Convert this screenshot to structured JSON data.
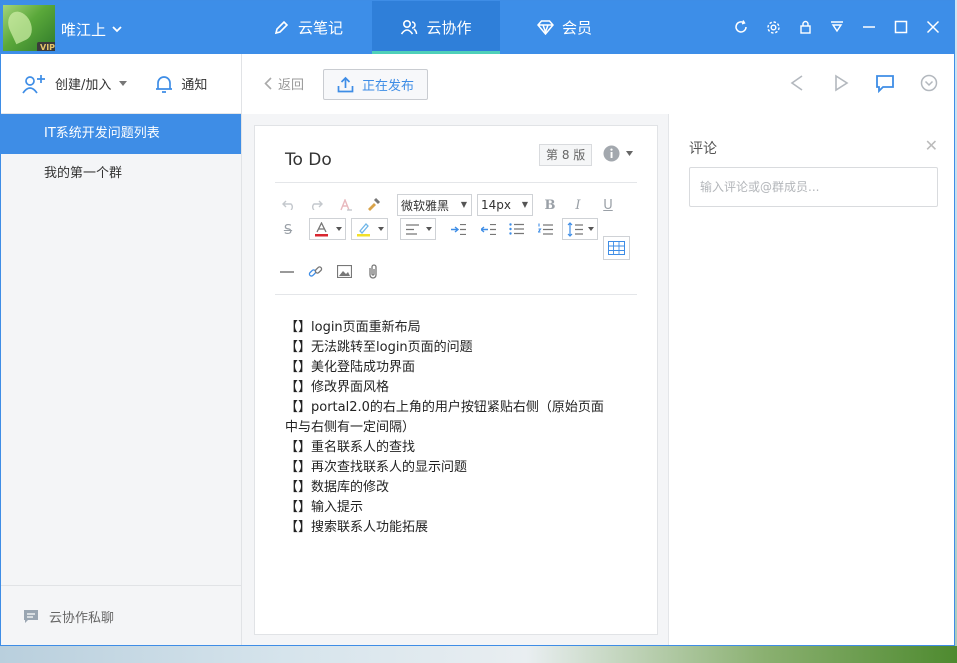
{
  "titlebar": {
    "username": "唯江上",
    "vip_badge": "VIP",
    "tabs": [
      {
        "label": "云笔记",
        "icon": "pencil-icon"
      },
      {
        "label": "云协作",
        "icon": "users-icon"
      },
      {
        "label": "会员",
        "icon": "diamond-icon"
      }
    ],
    "window_icons": [
      "refresh-icon",
      "gear-icon",
      "lock-icon",
      "skin-icon",
      "minimize-icon",
      "maximize-icon",
      "close-icon"
    ]
  },
  "sidebar": {
    "create_join": "创建/加入",
    "notify": "通知",
    "groups": [
      "IT系统开发问题列表",
      "我的第一个群"
    ],
    "footer": "云协作私聊"
  },
  "toolbar": {
    "back": "返回",
    "publish": "正在发布"
  },
  "document": {
    "title": "To Do",
    "version": "第 8 版",
    "font_family": "微软雅黑",
    "font_size": "14px",
    "lines": [
      "【】login页面重新布局",
      "【】无法跳转至login页面的问题",
      "【】美化登陆成功界面",
      "【】修改界面风格",
      "【】portal2.0的右上角的用户按钮紧贴右侧（原始页面中与右侧有一定间隔）",
      "【】重名联系人的查找",
      "【】再次查找联系人的显示问题",
      "【】数据库的修改",
      "【】输入提示",
      "【】搜索联系人功能拓展"
    ]
  },
  "comments": {
    "title": "评论",
    "placeholder": "输入评论或@群成员..."
  },
  "colors": {
    "brand_blue": "#3d8ee8",
    "active_tab": "#2f7fd9",
    "tab_underline": "#4fd0b9"
  }
}
